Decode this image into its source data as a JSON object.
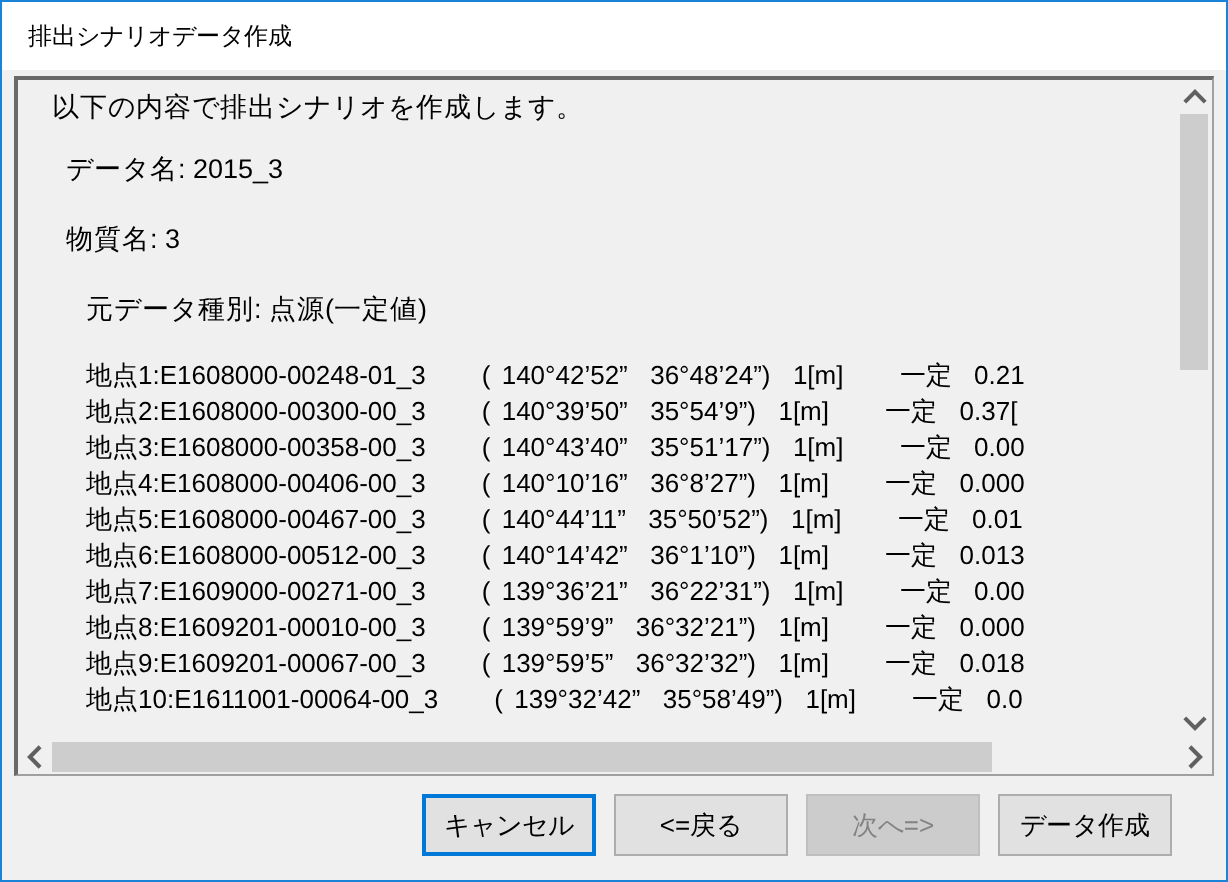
{
  "window": {
    "title": "排出シナリオデータ作成"
  },
  "intro": "以下の内容で排出シナリオを作成します。",
  "data_name": "データ名: 2015_3",
  "substance_name": "物質名: 3",
  "source_type": "元データ種別: 点源(一定値)",
  "points": [
    "地点1:E1608000-00248-01_3     ( 140°42’52”  36°48’24”)  1[m]     一定  0.21",
    "地点2:E1608000-00300-00_3     ( 140°39’50”  35°54’9”)  1[m]     一定  0.37[",
    "地点3:E1608000-00358-00_3     ( 140°43’40”  35°51’17”)  1[m]     一定  0.00",
    "地点4:E1608000-00406-00_3     ( 140°10’16”  36°8’27”)  1[m]     一定  0.000",
    "地点5:E1608000-00467-00_3     ( 140°44’11”  35°50’52”)  1[m]     一定  0.01",
    "地点6:E1608000-00512-00_3     ( 140°14’42”  36°1’10”)  1[m]     一定  0.013",
    "地点7:E1609000-00271-00_3     ( 139°36’21”  36°22’31”)  1[m]     一定  0.00",
    "地点8:E1609201-00010-00_3     ( 139°59’9”  36°32’21”)  1[m]     一定  0.000",
    "地点9:E1609201-00067-00_3     ( 139°59’5”  36°32’32”)  1[m]     一定  0.018",
    "地点10:E1611001-00064-00_3     ( 139°32’42”  35°58’49”)  1[m]     一定  0.0"
  ],
  "buttons": [
    {
      "label": "キャンセル",
      "focused": true,
      "disabled": false
    },
    {
      "label": "<=戻る",
      "focused": false,
      "disabled": false
    },
    {
      "label": "次へ=>",
      "focused": false,
      "disabled": true
    },
    {
      "label": "データ作成",
      "focused": false,
      "disabled": false
    }
  ]
}
